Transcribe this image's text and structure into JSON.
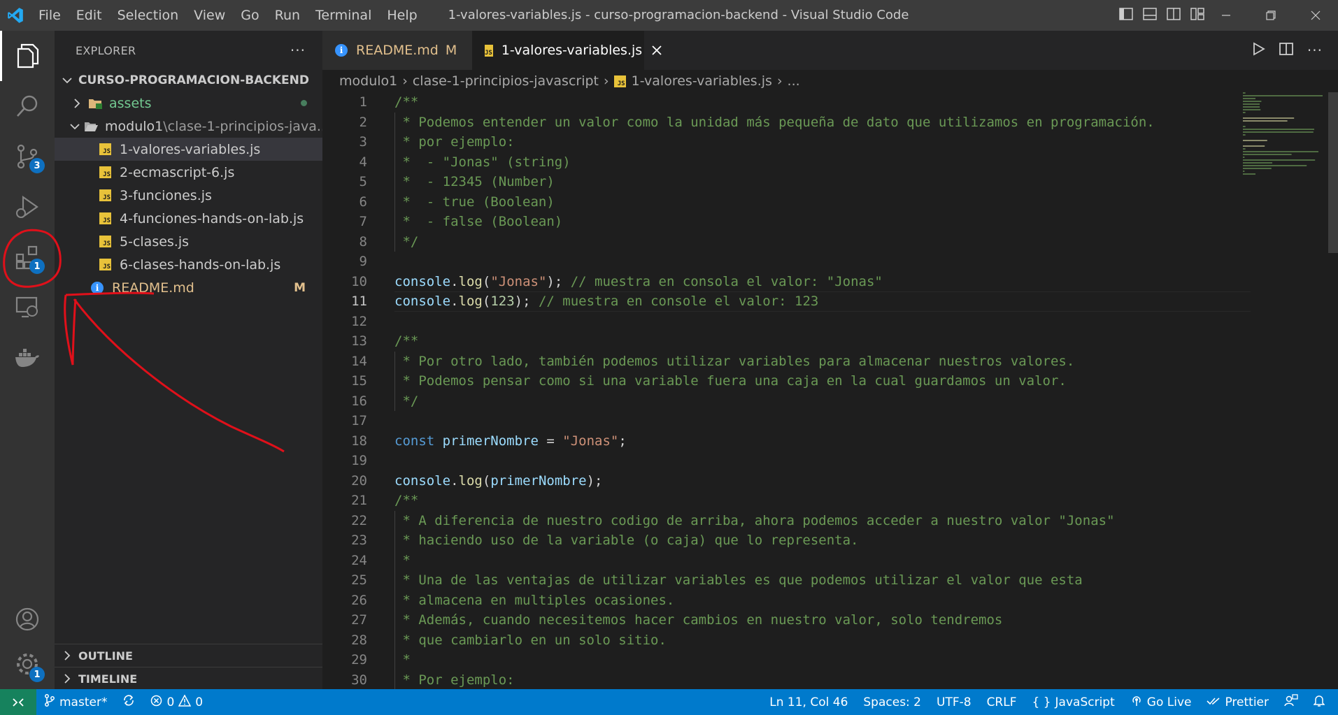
{
  "titlebar": {
    "menu": [
      "File",
      "Edit",
      "Selection",
      "View",
      "Go",
      "Run",
      "Terminal",
      "Help"
    ],
    "window_title": "1-valores-variables.js - curso-programacion-backend - Visual Studio Code"
  },
  "activitybar": {
    "items": [
      {
        "name": "explorer-icon"
      },
      {
        "name": "search-icon"
      },
      {
        "name": "source-control-icon",
        "badge": "3"
      },
      {
        "name": "run-debug-icon"
      },
      {
        "name": "extensions-icon",
        "badge": "1"
      },
      {
        "name": "remote-explorer-icon"
      },
      {
        "name": "docker-icon"
      }
    ],
    "bottom": [
      {
        "name": "accounts-icon"
      },
      {
        "name": "manage-gear-icon",
        "badge": "1"
      }
    ]
  },
  "sidebar": {
    "title": "EXPLORER",
    "more": "···",
    "root": "CURSO-PROGRAMACION-BACKEND",
    "tree": {
      "assets": "assets",
      "modulo1": "modulo1",
      "modulo1_sub": "\\clase-1-principios-java...",
      "files": [
        "1-valores-variables.js",
        "2-ecmascript-6.js",
        "3-funciones.js",
        "4-funciones-hands-on-lab.js",
        "5-clases.js",
        "6-clases-hands-on-lab.js"
      ],
      "readme": "README.md",
      "readme_badge": "M"
    },
    "outline": "OUTLINE",
    "timeline": "TIMELINE"
  },
  "tabs": {
    "readme": {
      "label": "README.md",
      "badge": "M"
    },
    "active": {
      "label": "1-valores-variables.js",
      "icon_text": "JS"
    }
  },
  "breadcrumbs": {
    "parts": [
      "modulo1",
      "clase-1-principios-javascript",
      "1-valores-variables.js",
      "..."
    ]
  },
  "editor": {
    "current_line": 11,
    "lines": [
      "/**",
      " * Podemos entender un valor como la unidad más pequeña de dato que utilizamos en programación.",
      " * por ejemplo:",
      " *  - \"Jonas\" (string)",
      " *  - 12345 (Number)",
      " *  - true (Boolean)",
      " *  - false (Boolean)",
      " */",
      "",
      "console.log(\"Jonas\"); // muestra en consola el valor: \"Jonas\"",
      "console.log(123); // muestra en console el valor: 123",
      "",
      "/**",
      " * Por otro lado, también podemos utilizar variables para almacenar nuestros valores.",
      " * Podemos pensar como si una variable fuera una caja en la cual guardamos un valor.",
      " */",
      "",
      "const primerNombre = \"Jonas\";",
      "",
      "console.log(primerNombre);",
      "/**",
      " * A diferencia de nuestro codigo de arriba, ahora podemos acceder a nuestro valor \"Jonas\"",
      " * haciendo uso de la variable (o caja) que lo representa.",
      " *",
      " * Una de las ventajas de utilizar variables es que podemos utilizar el valor que esta",
      " * almacena en multiples ocasiones.",
      " * Además, cuando necesitemos hacer cambios en nuestro valor, solo tendremos",
      " * que cambiarlo en un solo sitio.",
      " *",
      " * Por ejemplo:"
    ]
  },
  "statusbar": {
    "branch": "master*",
    "errors": "0",
    "warnings": "0",
    "position": "Ln 11, Col 46",
    "spaces": "Spaces: 2",
    "encoding": "UTF-8",
    "eol": "CRLF",
    "language_icon": "{ }",
    "language": "JavaScript",
    "go_live": "Go Live",
    "prettier": "Prettier"
  },
  "colors": {
    "accent": "#007acc",
    "remote": "#16825d",
    "annotation": "#e0101a"
  }
}
